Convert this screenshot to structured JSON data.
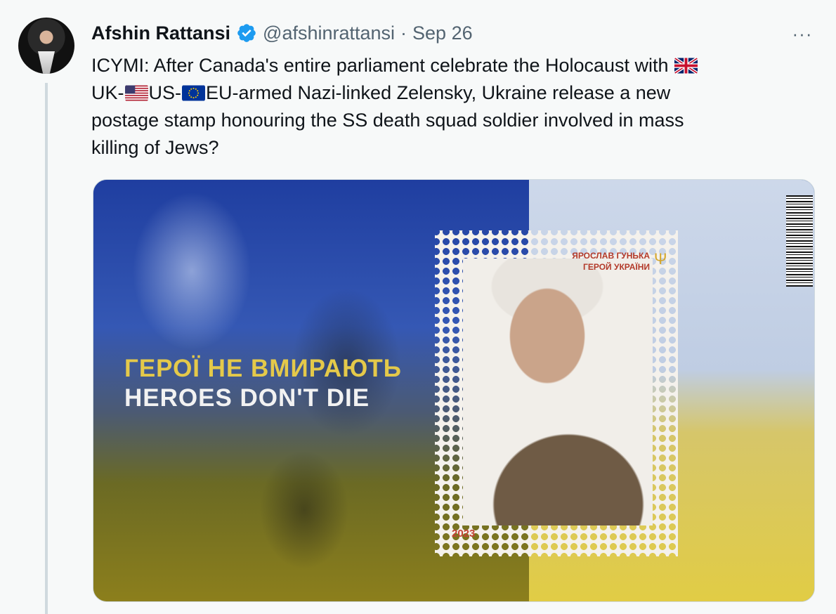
{
  "tweet": {
    "author_name": "Afshin Rattansi",
    "handle": "@afshinrattansi",
    "separator": "·",
    "date": "Sep 26",
    "more_label": "···",
    "text": {
      "line1": "ICYMI: After Canada's entire parliament celebrate the Holocaust with",
      "line2_a": "UK-",
      "line2_b": "US-",
      "line2_c": "EU-armed Nazi-linked Zelensky, Ukraine release a new",
      "line3": "postage stamp honouring the SS death squad soldier involved in mass",
      "line4": "killing of Jews?"
    }
  },
  "media": {
    "headline_ua": "ГЕРОЇ НЕ ВМИРАЮТЬ",
    "headline_en": "HEROES DON'T DIE",
    "stamp_name_line1": "ЯРОСЛАВ ГУНЬКА",
    "stamp_name_line2": "ГЕРОЙ УКРАЇНИ",
    "stamp_year": "2023"
  },
  "colors": {
    "verified": "#1d9bf0",
    "secondary_text": "#536471",
    "ukraine_yellow": "#e4c94a",
    "ukraine_blue": "#3558b4"
  },
  "icons": [
    "verified-badge-icon",
    "more-options-icon",
    "uk-flag-icon",
    "us-flag-icon",
    "eu-flag-icon"
  ]
}
